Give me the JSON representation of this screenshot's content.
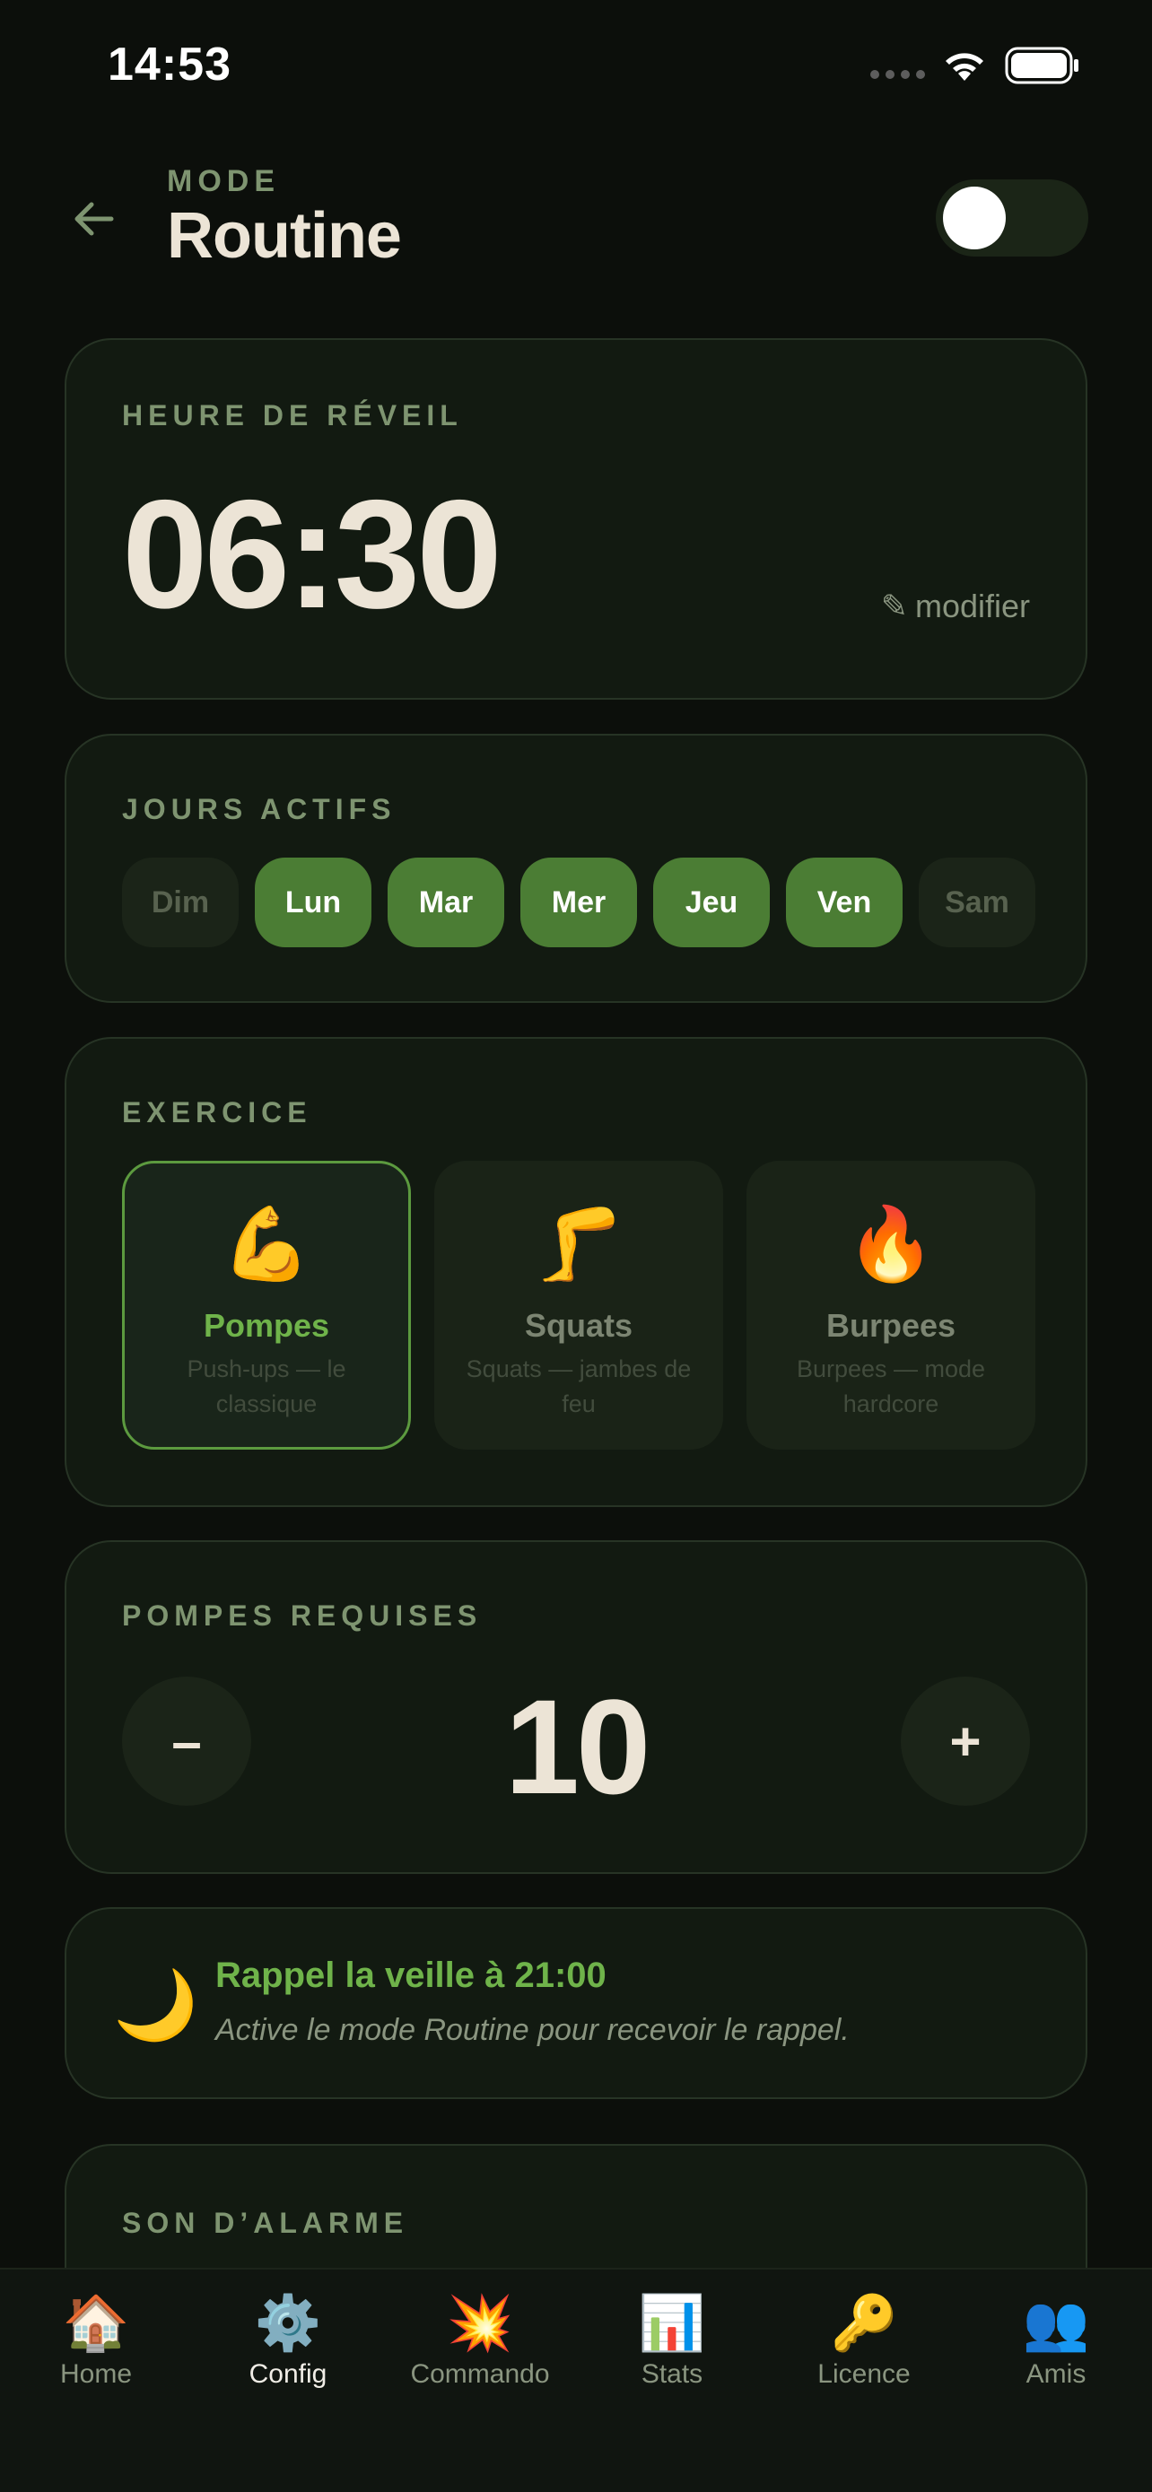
{
  "status_bar": {
    "time": "14:53"
  },
  "header": {
    "mode_label": "MODE",
    "title": "Routine",
    "mode_enabled": false
  },
  "wake": {
    "label": "HEURE DE RÉVEIL",
    "time": "06:30",
    "edit_icon": "pencil-icon",
    "edit_glyph": "✎",
    "edit_label": "modifier"
  },
  "days": {
    "label": "JOURS ACTIFS",
    "items": [
      {
        "label": "Dim",
        "active": false
      },
      {
        "label": "Lun",
        "active": true
      },
      {
        "label": "Mar",
        "active": true
      },
      {
        "label": "Mer",
        "active": true
      },
      {
        "label": "Jeu",
        "active": true
      },
      {
        "label": "Ven",
        "active": true
      },
      {
        "label": "Sam",
        "active": false
      }
    ]
  },
  "exercise": {
    "label": "EXERCICE",
    "items": [
      {
        "emoji": "💪",
        "icon": "flexed-biceps-icon",
        "name": "Pompes",
        "desc": "Push-ups — le classique",
        "selected": true
      },
      {
        "emoji": "🦵",
        "icon": "leg-icon",
        "name": "Squats",
        "desc": "Squats — jambes de feu",
        "selected": false
      },
      {
        "emoji": "🔥",
        "icon": "fire-icon",
        "name": "Burpees",
        "desc": "Burpees — mode hardcore",
        "selected": false
      }
    ]
  },
  "count": {
    "label": "POMPES REQUISES",
    "minus_label": "–",
    "value": "10",
    "plus_label": "+"
  },
  "reminder": {
    "icon": "crescent-moon-icon",
    "emoji": "🌙",
    "title": "Rappel la veille à 21:00",
    "text": "Active le mode Routine pour recevoir le rappel."
  },
  "sound": {
    "label": "SON D’ALARME"
  },
  "tabs": [
    {
      "emoji": "🏠",
      "icon": "house-icon",
      "label": "Home",
      "active": false
    },
    {
      "emoji": "⚙️",
      "icon": "gear-icon",
      "label": "Config",
      "active": true
    },
    {
      "emoji": "💥",
      "icon": "collision-icon",
      "label": "Commando",
      "active": false
    },
    {
      "emoji": "📊",
      "icon": "bar-chart-icon",
      "label": "Stats",
      "active": false
    },
    {
      "emoji": "🔑",
      "icon": "key-icon",
      "label": "Licence",
      "active": false
    },
    {
      "emoji": "👥",
      "icon": "users-icon",
      "label": "Amis",
      "active": false
    }
  ],
  "colors": {
    "background": "#0c0f0b",
    "card": "#121a11",
    "accent": "#4b7d34",
    "accent_text": "#6fb34a",
    "label": "#7e9470",
    "text": "#ece4d6"
  }
}
